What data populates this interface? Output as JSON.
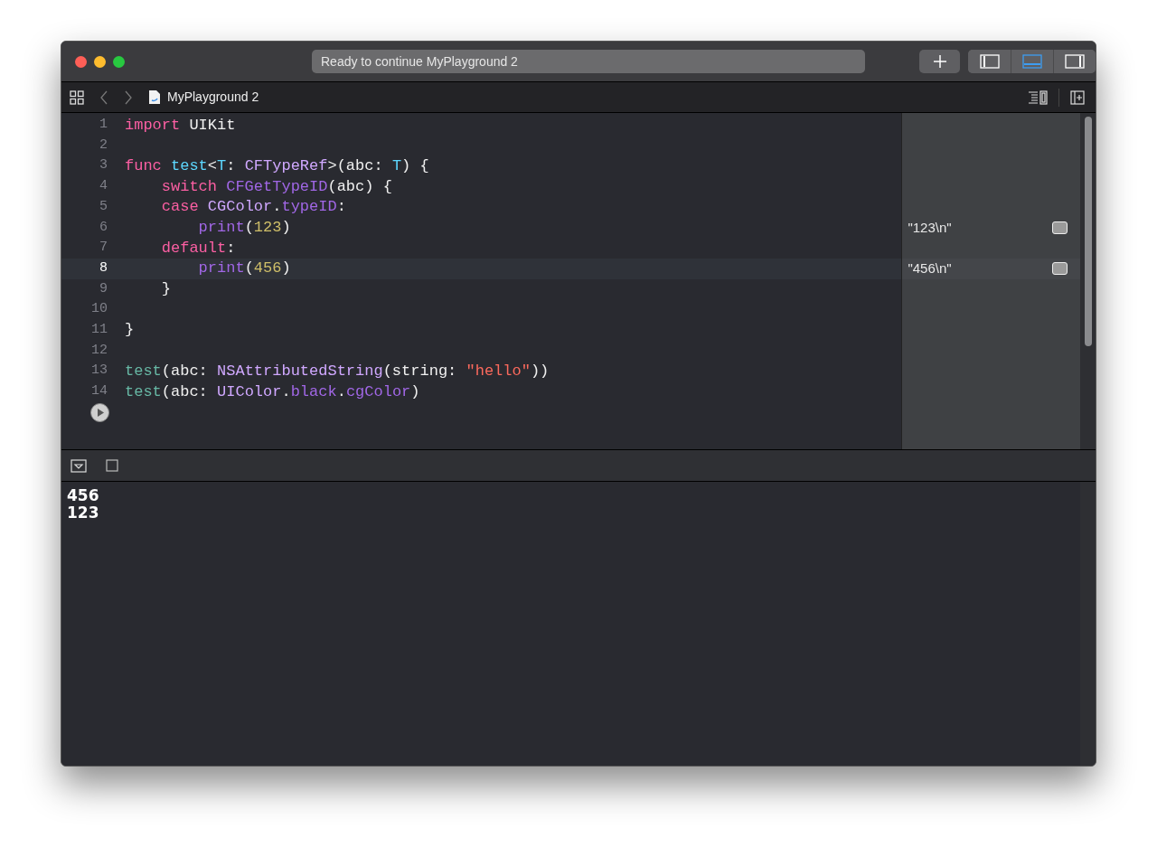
{
  "toolbar": {
    "status": "Ready to continue MyPlayground 2",
    "view_toggles": [
      {
        "kind": "left",
        "selected": false
      },
      {
        "kind": "bottom",
        "selected": true
      },
      {
        "kind": "right",
        "selected": false
      }
    ]
  },
  "jump_bar": {
    "file": "MyPlayground 2"
  },
  "editor": {
    "lines": [
      {
        "number": "1",
        "current": false,
        "tokens": [
          {
            "kind": "keyword",
            "text": "import"
          },
          {
            "kind": "plain",
            "text": " UIKit"
          }
        ]
      },
      {
        "number": "2",
        "current": false
      },
      {
        "number": "3",
        "current": false,
        "tokens": [
          {
            "kind": "keyword",
            "text": "func "
          },
          {
            "kind": "decl",
            "text": "test"
          },
          {
            "kind": "plain",
            "text": "<"
          },
          {
            "kind": "decl",
            "text": "T"
          },
          {
            "kind": "plain",
            "text": ": "
          },
          {
            "kind": "type",
            "text": "CFTypeRef"
          },
          {
            "kind": "plain",
            "text": ">(abc: "
          },
          {
            "kind": "decl",
            "text": "T"
          },
          {
            "kind": "plain",
            "text": ") {"
          }
        ]
      },
      {
        "number": "4",
        "current": false,
        "tokens": [
          {
            "kind": "keyword",
            "text": "    switch "
          },
          {
            "kind": "method",
            "text": "CFGetTypeID"
          },
          {
            "kind": "plain",
            "text": "(abc) {"
          }
        ]
      },
      {
        "number": "5",
        "current": false,
        "tokens": [
          {
            "kind": "keyword",
            "text": "    case "
          },
          {
            "kind": "type",
            "text": "CGColor"
          },
          {
            "kind": "plain",
            "text": "."
          },
          {
            "kind": "method",
            "text": "typeID"
          },
          {
            "kind": "plain",
            "text": ":"
          }
        ]
      },
      {
        "number": "6",
        "current": false,
        "result": "\"123\\n\"",
        "tokens": [
          {
            "kind": "method",
            "text": "        print"
          },
          {
            "kind": "plain",
            "text": "("
          },
          {
            "kind": "number",
            "text": "123"
          },
          {
            "kind": "plain",
            "text": ")"
          }
        ]
      },
      {
        "number": "7",
        "current": false,
        "tokens": [
          {
            "kind": "keyword",
            "text": "    default"
          },
          {
            "kind": "plain",
            "text": ":"
          }
        ]
      },
      {
        "number": "8",
        "current": true,
        "result": "\"456\\n\"",
        "tokens": [
          {
            "kind": "method",
            "text": "        print"
          },
          {
            "kind": "plain",
            "text": "("
          },
          {
            "kind": "number",
            "text": "456"
          },
          {
            "kind": "plain",
            "text": ")"
          }
        ]
      },
      {
        "number": "9",
        "current": false,
        "tokens": [
          {
            "kind": "plain",
            "text": "    }"
          }
        ]
      },
      {
        "number": "10",
        "current": false
      },
      {
        "number": "11",
        "current": false,
        "tokens": [
          {
            "kind": "plain",
            "text": "}"
          }
        ]
      },
      {
        "number": "12",
        "current": false
      },
      {
        "number": "13",
        "current": false,
        "tokens": [
          {
            "kind": "call",
            "text": "test"
          },
          {
            "kind": "plain",
            "text": "(abc: "
          },
          {
            "kind": "type",
            "text": "NSAttributedString"
          },
          {
            "kind": "plain",
            "text": "(string: "
          },
          {
            "kind": "string",
            "text": "\"hello\""
          },
          {
            "kind": "plain",
            "text": "))"
          }
        ]
      },
      {
        "number": "14",
        "current": false,
        "tokens": [
          {
            "kind": "call",
            "text": "test"
          },
          {
            "kind": "plain",
            "text": "(abc: "
          },
          {
            "kind": "type",
            "text": "UIColor"
          },
          {
            "kind": "plain",
            "text": "."
          },
          {
            "kind": "method",
            "text": "black"
          },
          {
            "kind": "plain",
            "text": "."
          },
          {
            "kind": "method",
            "text": "cgColor"
          },
          {
            "kind": "plain",
            "text": ")"
          }
        ]
      }
    ]
  },
  "console": {
    "output": [
      "456",
      "123"
    ]
  }
}
